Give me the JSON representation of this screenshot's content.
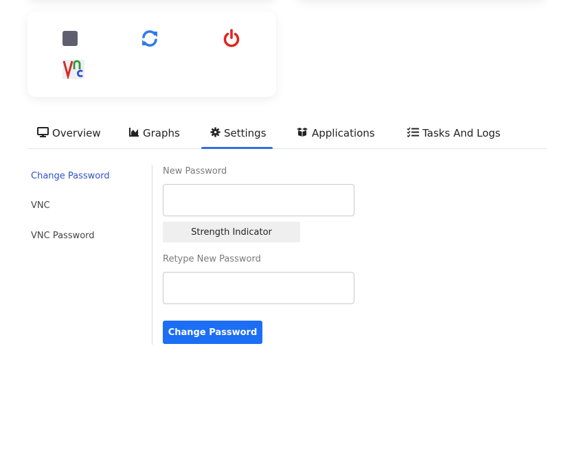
{
  "controls": {
    "stop_icon": "stop-icon",
    "restart_icon": "restart-icon",
    "power_icon": "power-icon",
    "vnc_icon": "vnc-logo-icon"
  },
  "tabs": [
    {
      "label": "Overview",
      "icon": "monitor-icon"
    },
    {
      "label": "Graphs",
      "icon": "area-chart-icon"
    },
    {
      "label": "Settings",
      "icon": "gear-icon",
      "active": true
    },
    {
      "label": "Applications",
      "icon": "boxes-icon"
    },
    {
      "label": "Tasks And Logs",
      "icon": "task-list-icon"
    }
  ],
  "settings_nav": [
    {
      "label": "Change Password",
      "active": true
    },
    {
      "label": "VNC"
    },
    {
      "label": "VNC Password"
    }
  ],
  "form": {
    "new_password_label": "New Password",
    "new_password_value": "",
    "strength_indicator": "Strength Indicator",
    "retype_label": "Retype New Password",
    "retype_value": "",
    "submit_label": "Change Password"
  },
  "colors": {
    "accent": "#2f6fe6",
    "primary_button": "#1c6ef5",
    "active_nav": "#2f53c8",
    "restart_icon": "#2f7ce8",
    "power_icon": "#e0251f",
    "stop_icon": "#5f5e6e"
  }
}
